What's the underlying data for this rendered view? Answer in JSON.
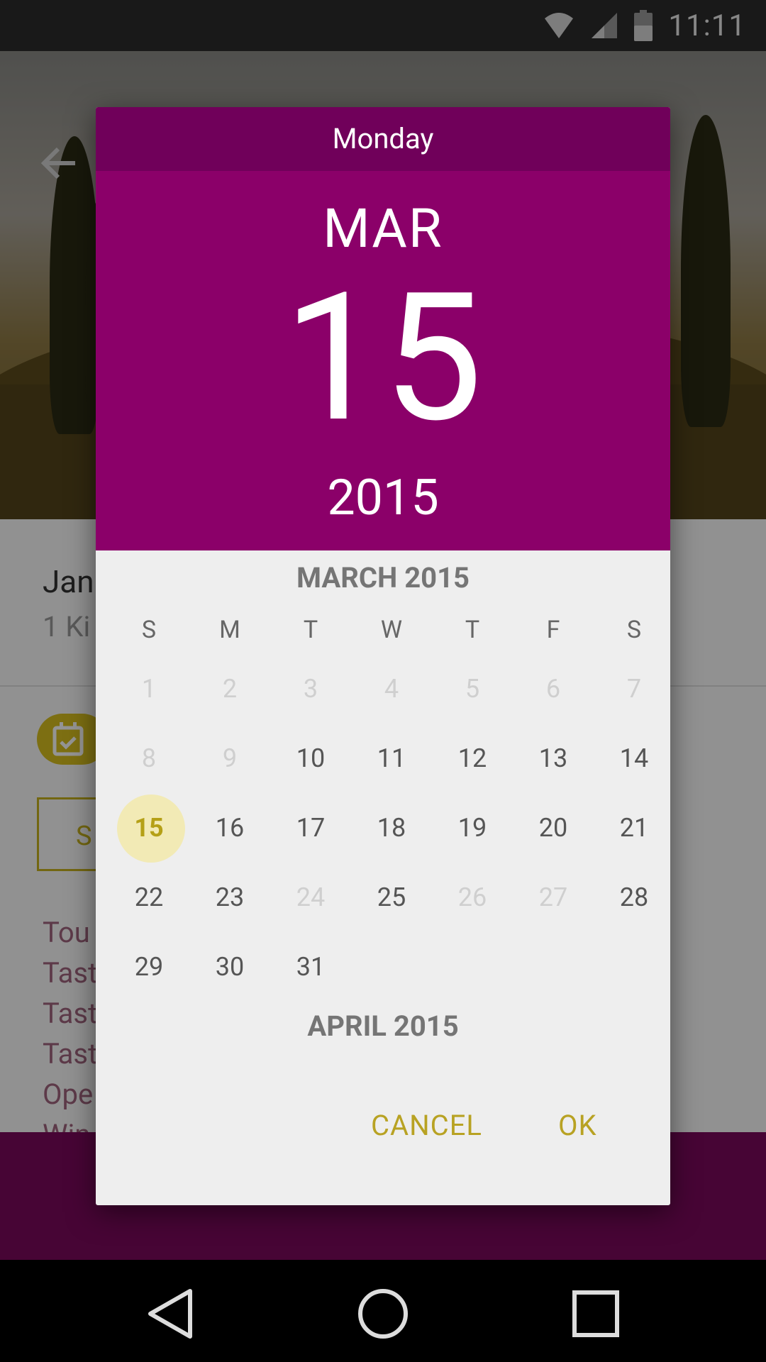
{
  "status_bar": {
    "time": "11:11",
    "icons": [
      "wifi-icon",
      "signal-icon",
      "battery-icon"
    ]
  },
  "background_app": {
    "title_partial": "Jan",
    "subtitle_partial": "1 Ki",
    "button_partial": "S",
    "list_partial": [
      "Tou",
      "Tast",
      "Tast",
      "Tast",
      "Ope",
      "Win"
    ]
  },
  "dialog": {
    "day_of_week": "Monday",
    "month": "MAR",
    "date": "15",
    "year": "2015",
    "calendar_title": "MARCH 2015",
    "next_month_title": "APRIL 2015",
    "weekdays": [
      "S",
      "M",
      "T",
      "W",
      "T",
      "F",
      "S"
    ],
    "days": [
      {
        "label": "1",
        "enabled": false
      },
      {
        "label": "2",
        "enabled": false
      },
      {
        "label": "3",
        "enabled": false
      },
      {
        "label": "4",
        "enabled": false
      },
      {
        "label": "5",
        "enabled": false
      },
      {
        "label": "6",
        "enabled": false
      },
      {
        "label": "7",
        "enabled": false
      },
      {
        "label": "8",
        "enabled": false
      },
      {
        "label": "9",
        "enabled": false
      },
      {
        "label": "10",
        "enabled": true
      },
      {
        "label": "11",
        "enabled": true
      },
      {
        "label": "12",
        "enabled": true
      },
      {
        "label": "13",
        "enabled": true
      },
      {
        "label": "14",
        "enabled": true
      },
      {
        "label": "15",
        "enabled": true,
        "selected": true
      },
      {
        "label": "16",
        "enabled": true
      },
      {
        "label": "17",
        "enabled": true
      },
      {
        "label": "18",
        "enabled": true
      },
      {
        "label": "19",
        "enabled": true
      },
      {
        "label": "20",
        "enabled": true
      },
      {
        "label": "21",
        "enabled": true
      },
      {
        "label": "22",
        "enabled": true
      },
      {
        "label": "23",
        "enabled": true
      },
      {
        "label": "24",
        "enabled": false
      },
      {
        "label": "25",
        "enabled": true
      },
      {
        "label": "26",
        "enabled": false
      },
      {
        "label": "27",
        "enabled": false
      },
      {
        "label": "28",
        "enabled": true
      },
      {
        "label": "29",
        "enabled": true
      },
      {
        "label": "30",
        "enabled": true
      },
      {
        "label": "31",
        "enabled": true
      }
    ],
    "cancel_label": "CANCEL",
    "ok_label": "OK"
  },
  "colors": {
    "header_dark": "#70005a",
    "header": "#8b0069",
    "accent": "#b8a223",
    "selected_bg": "#f2eab5"
  },
  "nav_bar": {
    "buttons": [
      "back-icon",
      "home-icon",
      "recents-icon"
    ]
  }
}
